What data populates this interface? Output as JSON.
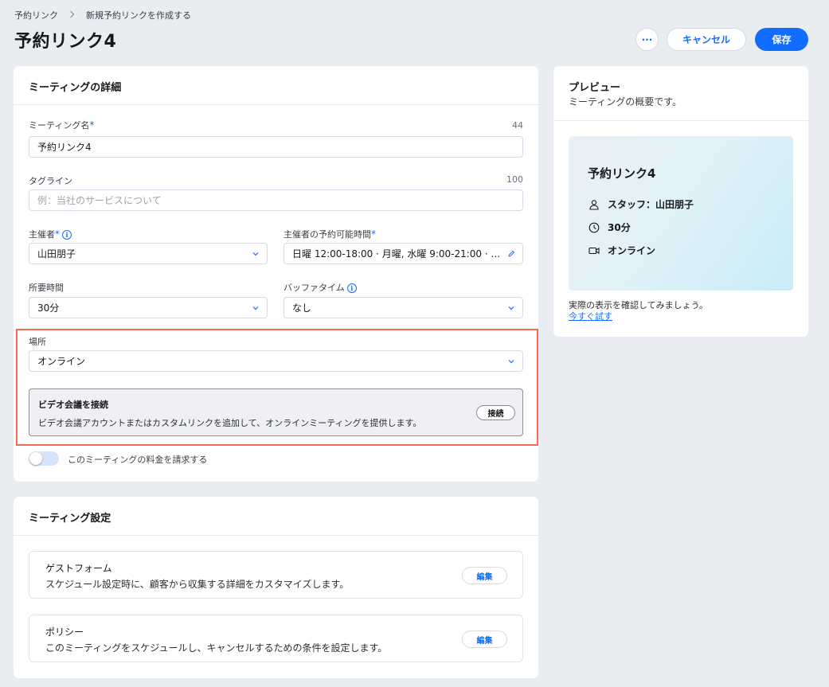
{
  "breadcrumb": {
    "root": "予約リンク",
    "current": "新規予約リンクを作成する"
  },
  "header": {
    "title": "予約リンク4",
    "more_label": "···",
    "cancel_label": "キャンセル",
    "save_label": "保存"
  },
  "details": {
    "title": "ミーティングの詳細",
    "name": {
      "label": "ミーティング名",
      "required": "*",
      "counter": "44",
      "value": "予約リンク4"
    },
    "tagline": {
      "label": "タグライン",
      "counter": "100",
      "placeholder": "例：当社のサービスについて"
    },
    "host": {
      "label": "主催者",
      "required": "*",
      "value": "山田朋子"
    },
    "availability": {
      "label": "主催者の予約可能時間",
      "required": "*",
      "value": "日曜 12:00-18:00 · 月曜, 水曜 9:00-21:00 · ..."
    },
    "duration": {
      "label": "所要時間",
      "value": "30分"
    },
    "buffer": {
      "label": "バッファタイム",
      "value": "なし"
    },
    "location": {
      "label": "場所",
      "value": "オンライン"
    },
    "video": {
      "title": "ビデオ会議を接続",
      "description": "ビデオ会議アカウントまたはカスタムリンクを追加して、オンラインミーティングを提供します。",
      "connect_label": "接続"
    },
    "charge_toggle_label": "このミーティングの料金を請求する"
  },
  "settings": {
    "title": "ミーティング設定",
    "items": [
      {
        "title": "ゲストフォーム",
        "description": "スケジュール設定時に、顧客から収集する詳細をカスタマイズします。",
        "edit_label": "編集"
      },
      {
        "title": "ポリシー",
        "description": "このミーティングをスケジュールし、キャンセルするための条件を設定します。",
        "edit_label": "編集"
      }
    ]
  },
  "preview": {
    "title": "プレビュー",
    "subtitle": "ミーティングの概要です。",
    "card_title": "予約リンク4",
    "staff": "スタッフ：山田朋子",
    "duration": "30分",
    "location": "オンライン",
    "footer_text": "実際の表示を確認してみましょう。",
    "try_link": "今すぐ試す"
  },
  "colors": {
    "accent": "#116dff",
    "highlight_border": "#f26d4f",
    "background": "#e9ecf1"
  },
  "icons": [
    "chevron-right-icon",
    "info-icon",
    "chevron-down-icon",
    "pencil-icon",
    "person-icon",
    "clock-icon",
    "video-icon"
  ]
}
